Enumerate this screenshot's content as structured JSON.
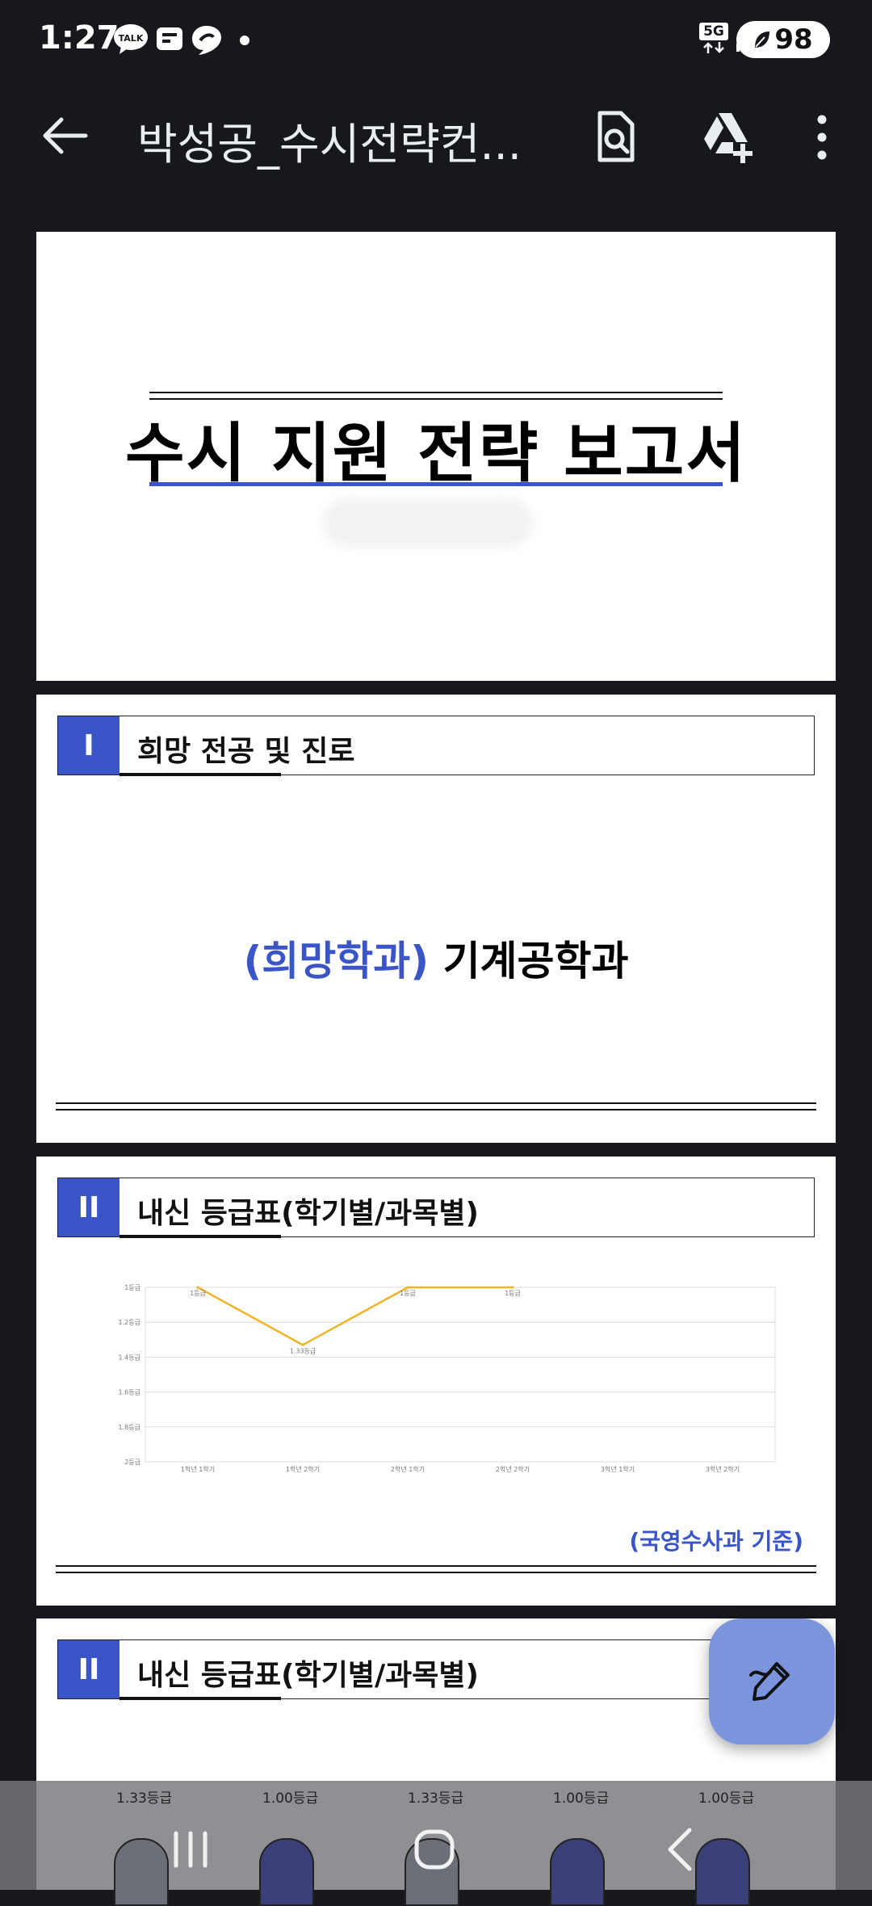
{
  "status_bar": {
    "time": "1:27",
    "network": "5G",
    "battery": "98",
    "icons": [
      "talk-icon",
      "news-icon",
      "thread-icon",
      "dot-icon",
      "signal-icon"
    ]
  },
  "app_bar": {
    "title": "박성공_수시전략컨...",
    "icons": [
      "back-arrow-icon",
      "document-search-icon",
      "drive-add-icon",
      "more-vert-icon"
    ]
  },
  "pages": {
    "cover": {
      "title": "수시 지원 전략 보고서"
    },
    "section1": {
      "number": "I",
      "title": "희망 전공 및 진로",
      "major_label": "(희망학과)",
      "major_value": "기계공학과"
    },
    "section2": {
      "number": "II",
      "title": "내신 등급표(학기별/과목별)",
      "note": "(국영수사과 기준)"
    },
    "section3": {
      "number": "II",
      "title": "내신 등급표(학기별/과목별)"
    }
  },
  "chart_data": {
    "type": "line",
    "categories": [
      "1학년 1학기",
      "1학년 2학기",
      "2학년 1학기",
      "2학년 2학기",
      "3학년 1학기",
      "3학년 2학기"
    ],
    "series": [
      {
        "values": [
          1,
          1.33,
          1,
          1,
          null,
          null
        ],
        "labels": [
          "1등급",
          "1.33등급",
          "1등급",
          "1등급",
          "",
          ""
        ]
      }
    ],
    "y_ticks": [
      "1등급",
      "1.2등급",
      "1.4등급",
      "1.6등급",
      "1.8등급",
      "2등급"
    ],
    "ylim": [
      1,
      2
    ],
    "y_inverted": true,
    "grid": true,
    "line_color": "#f0b429"
  },
  "bottom_chart_labels": [
    "1.33등급",
    "1.00등급",
    "1.33등급",
    "1.00등급",
    "1.00등급"
  ],
  "fab": {
    "icon": "edit-pen-icon"
  },
  "nav_bar": {
    "icons": [
      "recents-icon",
      "home-icon",
      "back-icon"
    ]
  }
}
